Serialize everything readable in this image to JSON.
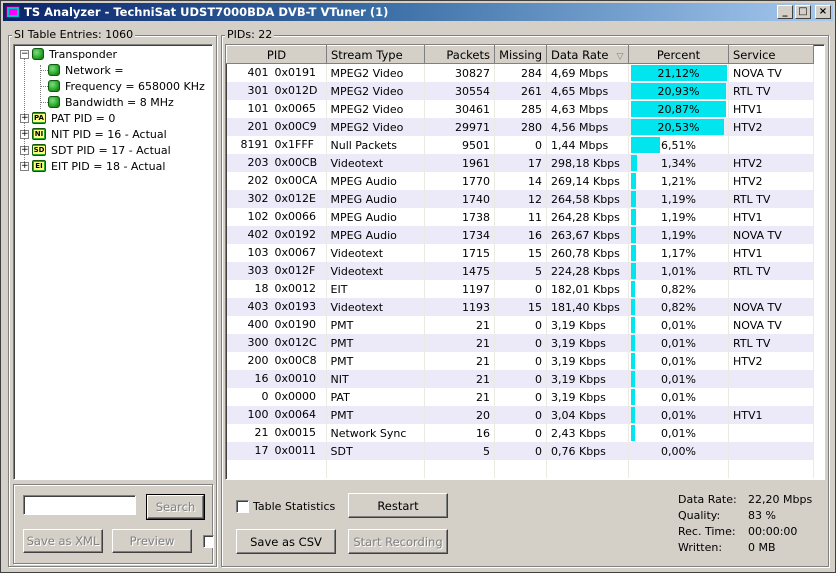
{
  "window": {
    "title": "TS Analyzer - TechniSat UDST7000BDA DVB-T VTuner (1)",
    "min_label": "_",
    "max_label": "□",
    "close_label": "×"
  },
  "left_panel": {
    "group_label": "SI Table Entries: 1060",
    "tree": {
      "root": "Transponder",
      "children": [
        "Network =",
        "Frequency = 658000 KHz",
        "Bandwidth = 8 MHz"
      ],
      "tables": [
        {
          "badge": "PA",
          "label": "PAT PID = 0"
        },
        {
          "badge": "NI",
          "label": "NIT PID = 16 - Actual"
        },
        {
          "badge": "SD",
          "label": "SDT PID = 17 - Actual"
        },
        {
          "badge": "EI",
          "label": "EIT PID = 18 - Actual"
        }
      ]
    },
    "search_value": "",
    "search_label": "Search",
    "save_xml_label": "Save as XML",
    "preview_label": "Preview"
  },
  "right_panel": {
    "group_label": "PIDs: 22",
    "columns": [
      "PID",
      "Stream Type",
      "Packets",
      "Missing",
      "Data Rate",
      "Percent",
      "Service"
    ],
    "sort_indicator": "▽",
    "rows": [
      {
        "pid": "401",
        "hex": "0x0191",
        "type": "MPEG2 Video",
        "packets": "30827",
        "missing": "284",
        "rate": "4,69 Mbps",
        "percent": "21,12%",
        "pct": 21.12,
        "service": "NOVA TV"
      },
      {
        "pid": "301",
        "hex": "0x012D",
        "type": "MPEG2 Video",
        "packets": "30554",
        "missing": "261",
        "rate": "4,65 Mbps",
        "percent": "20,93%",
        "pct": 20.93,
        "service": "RTL TV"
      },
      {
        "pid": "101",
        "hex": "0x0065",
        "type": "MPEG2 Video",
        "packets": "30461",
        "missing": "285",
        "rate": "4,63 Mbps",
        "percent": "20,87%",
        "pct": 20.87,
        "service": "HTV1"
      },
      {
        "pid": "201",
        "hex": "0x00C9",
        "type": "MPEG2 Video",
        "packets": "29971",
        "missing": "280",
        "rate": "4,56 Mbps",
        "percent": "20,53%",
        "pct": 20.53,
        "service": "HTV2"
      },
      {
        "pid": "8191",
        "hex": "0x1FFF",
        "type": "Null Packets",
        "packets": "9501",
        "missing": "0",
        "rate": "1,44 Mbps",
        "percent": "6,51%",
        "pct": 6.51,
        "service": ""
      },
      {
        "pid": "203",
        "hex": "0x00CB",
        "type": "Videotext",
        "packets": "1961",
        "missing": "17",
        "rate": "298,18 Kbps",
        "percent": "1,34%",
        "pct": 1.34,
        "service": "HTV2"
      },
      {
        "pid": "202",
        "hex": "0x00CA",
        "type": "MPEG Audio",
        "packets": "1770",
        "missing": "14",
        "rate": "269,14 Kbps",
        "percent": "1,21%",
        "pct": 1.21,
        "service": "HTV2"
      },
      {
        "pid": "302",
        "hex": "0x012E",
        "type": "MPEG Audio",
        "packets": "1740",
        "missing": "12",
        "rate": "264,58 Kbps",
        "percent": "1,19%",
        "pct": 1.19,
        "service": "RTL TV"
      },
      {
        "pid": "102",
        "hex": "0x0066",
        "type": "MPEG Audio",
        "packets": "1738",
        "missing": "11",
        "rate": "264,28 Kbps",
        "percent": "1,19%",
        "pct": 1.19,
        "service": "HTV1"
      },
      {
        "pid": "402",
        "hex": "0x0192",
        "type": "MPEG Audio",
        "packets": "1734",
        "missing": "16",
        "rate": "263,67 Kbps",
        "percent": "1,19%",
        "pct": 1.19,
        "service": "NOVA TV"
      },
      {
        "pid": "103",
        "hex": "0x0067",
        "type": "Videotext",
        "packets": "1715",
        "missing": "15",
        "rate": "260,78 Kbps",
        "percent": "1,17%",
        "pct": 1.17,
        "service": "HTV1"
      },
      {
        "pid": "303",
        "hex": "0x012F",
        "type": "Videotext",
        "packets": "1475",
        "missing": "5",
        "rate": "224,28 Kbps",
        "percent": "1,01%",
        "pct": 1.01,
        "service": "RTL TV"
      },
      {
        "pid": "18",
        "hex": "0x0012",
        "type": "EIT",
        "packets": "1197",
        "missing": "0",
        "rate": "182,01 Kbps",
        "percent": "0,82%",
        "pct": 0.82,
        "service": ""
      },
      {
        "pid": "403",
        "hex": "0x0193",
        "type": "Videotext",
        "packets": "1193",
        "missing": "15",
        "rate": "181,40 Kbps",
        "percent": "0,82%",
        "pct": 0.82,
        "service": "NOVA TV"
      },
      {
        "pid": "400",
        "hex": "0x0190",
        "type": "PMT",
        "packets": "21",
        "missing": "0",
        "rate": "3,19 Kbps",
        "percent": "0,01%",
        "pct": 0.01,
        "service": "NOVA TV"
      },
      {
        "pid": "300",
        "hex": "0x012C",
        "type": "PMT",
        "packets": "21",
        "missing": "0",
        "rate": "3,19 Kbps",
        "percent": "0,01%",
        "pct": 0.01,
        "service": "RTL TV"
      },
      {
        "pid": "200",
        "hex": "0x00C8",
        "type": "PMT",
        "packets": "21",
        "missing": "0",
        "rate": "3,19 Kbps",
        "percent": "0,01%",
        "pct": 0.01,
        "service": "HTV2"
      },
      {
        "pid": "16",
        "hex": "0x0010",
        "type": "NIT",
        "packets": "21",
        "missing": "0",
        "rate": "3,19 Kbps",
        "percent": "0,01%",
        "pct": 0.01,
        "service": ""
      },
      {
        "pid": "0",
        "hex": "0x0000",
        "type": "PAT",
        "packets": "21",
        "missing": "0",
        "rate": "3,19 Kbps",
        "percent": "0,01%",
        "pct": 0.01,
        "service": ""
      },
      {
        "pid": "100",
        "hex": "0x0064",
        "type": "PMT",
        "packets": "20",
        "missing": "0",
        "rate": "3,04 Kbps",
        "percent": "0,01%",
        "pct": 0.01,
        "service": "HTV1"
      },
      {
        "pid": "21",
        "hex": "0x0015",
        "type": "Network Sync",
        "packets": "16",
        "missing": "0",
        "rate": "2,43 Kbps",
        "percent": "0,01%",
        "pct": 0.01,
        "service": ""
      },
      {
        "pid": "17",
        "hex": "0x0011",
        "type": "SDT",
        "packets": "5",
        "missing": "0",
        "rate": "0,76 Kbps",
        "percent": "0,00%",
        "pct": 0.0,
        "service": ""
      }
    ],
    "table_statistics_label": "Table Statistics",
    "table_statistics_checked": false,
    "restart_label": "Restart",
    "save_csv_label": "Save as CSV",
    "start_recording_label": "Start Recording",
    "stats": {
      "data_rate_label": "Data Rate:",
      "data_rate": "22,20 Mbps",
      "quality_label": "Quality:",
      "quality": "83 %",
      "rec_time_label": "Rec. Time:",
      "rec_time": "00:00:00",
      "written_label": "Written:",
      "written": "0 MB"
    }
  },
  "colors": {
    "percent_bar": "#00e5ee",
    "title_start": "#0a246a",
    "title_end": "#a6caf0"
  }
}
